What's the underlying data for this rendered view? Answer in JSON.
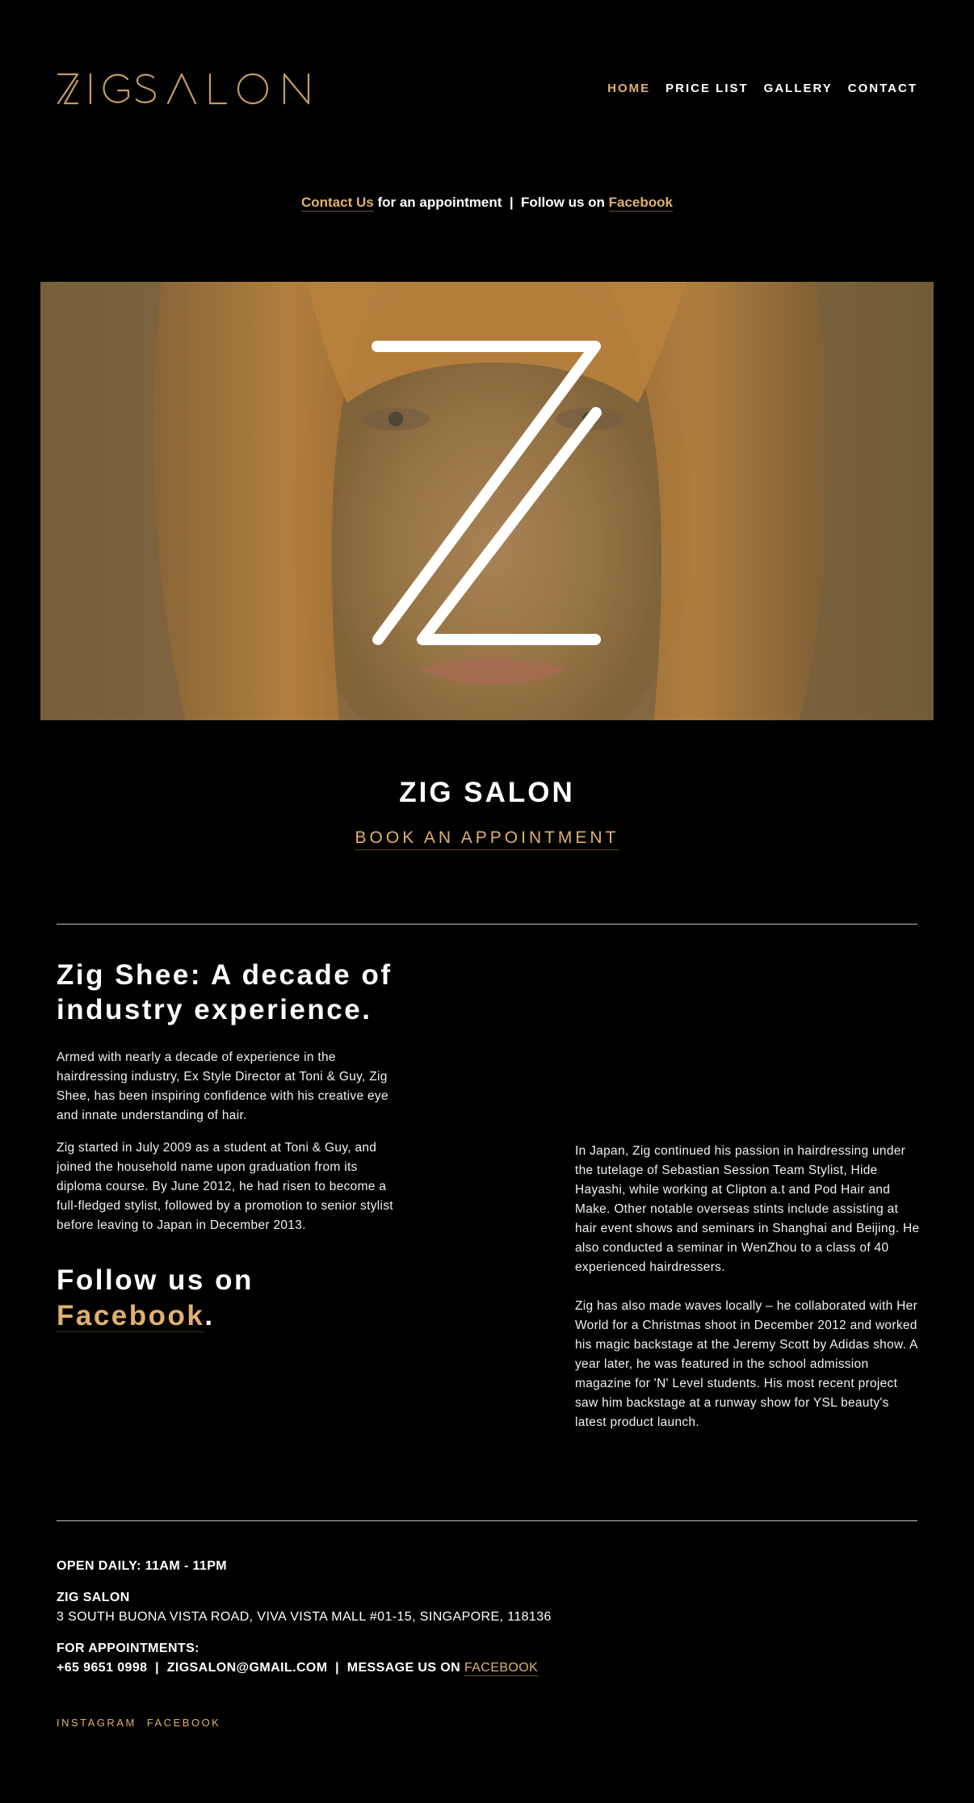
{
  "header": {
    "logo_text": "ZIGSALON",
    "nav": [
      {
        "label": "HOME",
        "active": true
      },
      {
        "label": "PRICE LIST",
        "active": false
      },
      {
        "label": "GALLERY",
        "active": false
      },
      {
        "label": "CONTACT",
        "active": false
      }
    ]
  },
  "tagline": {
    "contact_link": "Contact Us",
    "middle": " for an appointment  |  Follow us on ",
    "facebook_link": "Facebook"
  },
  "hero": {
    "overlay_letter": "Z"
  },
  "intro": {
    "title": "ZIG SALON",
    "book_label": "BOOK AN APPOINTMENT"
  },
  "about": {
    "heading": "Zig Shee: A decade of industry experience.",
    "p1": "Armed with nearly a decade of experience in the hairdressing industry, Ex Style Director at Toni & Guy, Zig Shee, has been inspiring confidence with his creative eye and innate understanding of hair.",
    "p2": "Zig started in July 2009 as a student at Toni & Guy, and joined the household name upon graduation from its diploma course. By June 2012, he had risen to become a full-fledged stylist, followed by a promotion to senior stylist before leaving to Japan in December 2013.",
    "p3": "In Japan, Zig continued his passion in hairdressing under the tutelage of Sebastian Session Team Stylist, Hide Hayashi, while working at Clipton a.t and Pod Hair and Make. Other notable overseas stints include assisting at hair event shows and seminars in Shanghai and Beijing. He also conducted a seminar in WenZhou to a class of 40 experienced hairdressers.",
    "p4": "Zig has also made waves locally – he collaborated with Her World for a Christmas shoot in December 2012 and worked his magic backstage at the Jeremy Scott by Adidas show. A year later, he was featured in the school admission magazine for 'N' Level students. His most recent project saw him backstage at a runway show for YSL beauty's latest product launch.",
    "follow_prefix": "Follow us on ",
    "follow_link": "Facebook",
    "follow_suffix": "."
  },
  "footer": {
    "hours": "OPEN DAILY: 11AM - 11PM",
    "name": "ZIG SALON",
    "address": "3 SOUTH BUONA VISTA ROAD, VIVA VISTA MALL #01-15, SINGAPORE, 118136",
    "appt_heading": "FOR APPOINTMENTS:",
    "phone": "+65 9651 0998",
    "sep": "  |  ",
    "email": "ZIGSALON@GMAIL.COM",
    "message_prefix": "MESSAGE US ON ",
    "message_link": "FACEBOOK",
    "social": [
      "INSTAGRAM",
      "FACEBOOK"
    ]
  },
  "colors": {
    "accent": "#e0b070",
    "background": "#000000",
    "text": "#ffffff"
  }
}
